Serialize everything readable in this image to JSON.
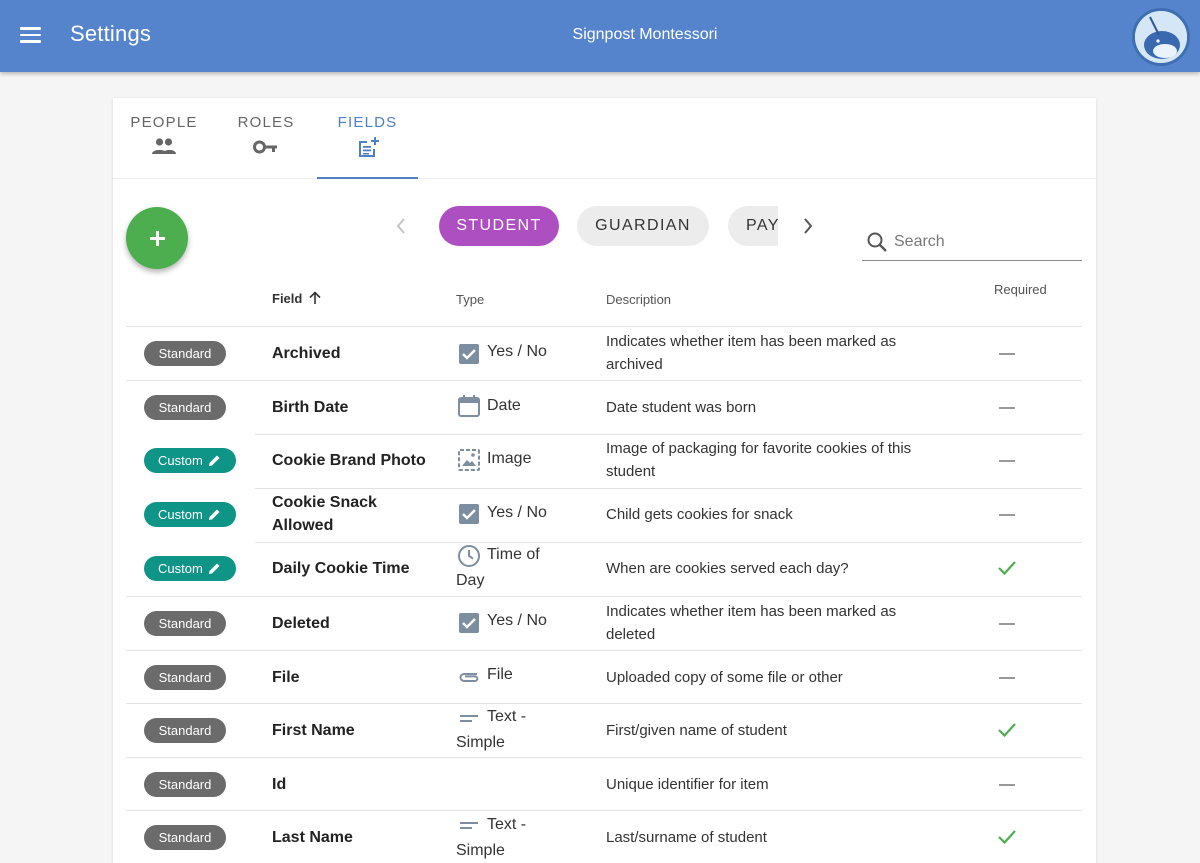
{
  "header": {
    "title": "Settings",
    "organization": "Signpost Montessori",
    "bar_color": "#5584cc"
  },
  "tabs": [
    {
      "label": "PEOPLE",
      "icon": "people-icon",
      "active": false
    },
    {
      "label": "ROLES",
      "icon": "key-icon",
      "active": false
    },
    {
      "label": "FIELDS",
      "icon": "post-add-icon",
      "active": true
    }
  ],
  "entity_chips": {
    "items": [
      {
        "label": "STUDENT",
        "selected": true
      },
      {
        "label": "GUARDIAN",
        "selected": false
      },
      {
        "label": "PAY",
        "selected": false
      }
    ],
    "selected_color": "#ad4fc0"
  },
  "search": {
    "placeholder": "Search",
    "value": ""
  },
  "table": {
    "headers": {
      "field": "Field",
      "type": "Type",
      "description": "Description",
      "required": "Required"
    },
    "sort": {
      "column": "Field",
      "direction": "ascending"
    },
    "rows": [
      {
        "badge": "Standard",
        "field": "Archived",
        "type": "Yes / No",
        "type_icon": "checkbox-icon",
        "description": "Indicates whether item has been marked as archived",
        "required": false
      },
      {
        "badge": "Standard",
        "field": "Birth Date",
        "type": "Date",
        "type_icon": "calendar-icon",
        "description": "Date student was born",
        "required": false
      },
      {
        "badge": "Custom",
        "field": "Cookie Brand Photo",
        "type": "Image",
        "type_icon": "image-icon",
        "description": "Image of packaging for favorite cookies of this student",
        "required": false
      },
      {
        "badge": "Custom",
        "field": "Cookie Snack Allowed",
        "type": "Yes / No",
        "type_icon": "checkbox-icon",
        "description": "Child gets cookies for snack",
        "required": false
      },
      {
        "badge": "Custom",
        "field": "Daily Cookie Time",
        "type": "Time of Day",
        "type_icon": "clock-icon",
        "description": "When are cookies served each day?",
        "required": true
      },
      {
        "badge": "Standard",
        "field": "Deleted",
        "type": "Yes / No",
        "type_icon": "checkbox-icon",
        "description": "Indicates whether item has been marked as deleted",
        "required": false
      },
      {
        "badge": "Standard",
        "field": "File",
        "type": "File",
        "type_icon": "paperclip-icon",
        "description": "Uploaded copy of some file or other",
        "required": false
      },
      {
        "badge": "Standard",
        "field": "First Name",
        "type": "Text - Simple",
        "type_icon": "short-text-icon",
        "description": "First/given name of student",
        "required": true
      },
      {
        "badge": "Standard",
        "field": "Id",
        "type": "",
        "type_icon": "",
        "description": "Unique identifier for item",
        "required": false
      },
      {
        "badge": "Standard",
        "field": "Last Name",
        "type": "Text - Simple",
        "type_icon": "short-text-icon",
        "description": "Last/surname of student",
        "required": true
      }
    ]
  },
  "colors": {
    "standard_badge": "#6b6b6b",
    "custom_badge": "#0f9488",
    "fab": "#4cae4f",
    "required_check": "#4cae4f",
    "active_tab": "#4f7fc4"
  }
}
